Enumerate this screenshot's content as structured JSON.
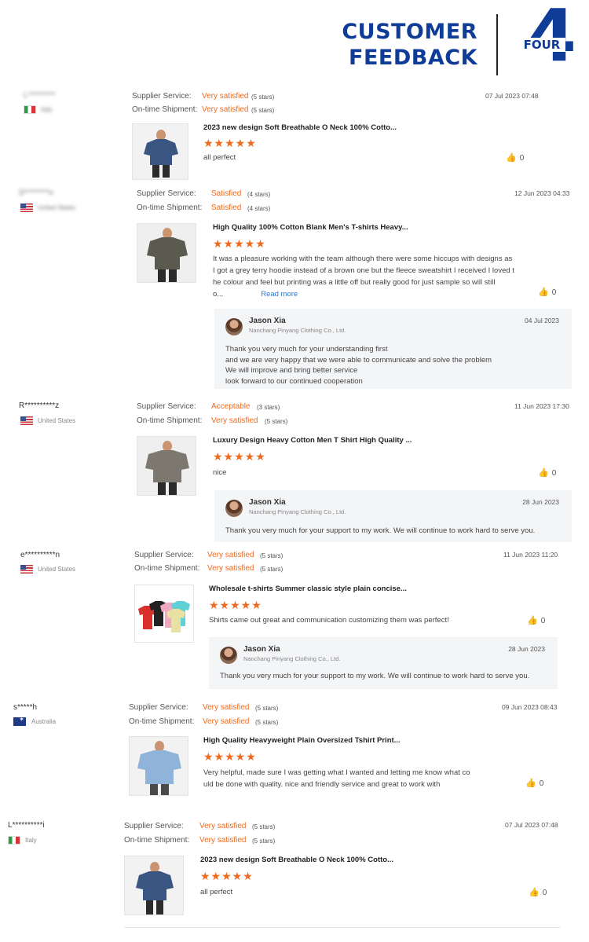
{
  "header": {
    "title_line1": "CUSTOMER",
    "title_line2": "FEEDBACK",
    "number": "4",
    "number_word": "FOUR"
  },
  "labels": {
    "supplier_service": "Supplier Service:",
    "ontime_shipment": "On-time Shipment:"
  },
  "reviews": [
    {
      "user": "L*********",
      "country": "Italy",
      "supplier_rating": "Very satisfied",
      "supplier_stars": "(5 stars)",
      "shipment_rating": "Very satisfied",
      "shipment_stars": "(5 stars)",
      "date": "07 Jul 2023 07:48",
      "product_title": "2023 new design Soft Breathable O Neck 100% Cotto...",
      "stars": "★★★★★",
      "text": "all perfect",
      "likes": "0",
      "thumbnail": "navy-tshirt"
    },
    {
      "user": "D********o",
      "country": "United States",
      "supplier_rating": "Satisfied",
      "supplier_stars": "(4 stars)",
      "shipment_rating": "Satisfied",
      "shipment_stars": "(4 stars)",
      "date": "12 Jun 2023 04:33",
      "product_title": "High Quality 100% Cotton Blank Men's T-shirts Heavy...",
      "stars": "★★★★★",
      "text_lines": [
        "It was a pleasure working with the team although there were some hiccups with designs as",
        "I got a grey terry hoodie instead of a brown one but the fleece sweatshirt I received I loved t",
        "he colour and feel but printing was a little off but really good for just sample so will still"
      ],
      "text_last": "o...",
      "read_more": "Read more",
      "likes": "0",
      "thumbnail": "olive-tshirt",
      "reply": {
        "name": "Jason Xia",
        "company": "Nanchang Pinyang Clothing Co., Ltd.",
        "date": "04 Jul 2023",
        "lines": [
          "Thank you very much for your understanding first",
          "and we are very happy that we were able to communicate and solve the problem",
          "We will improve and bring better service",
          "look forward to our continued cooperation"
        ]
      }
    },
    {
      "user": "R**********z",
      "country": "United States",
      "supplier_rating": "Acceptable",
      "supplier_stars": "(3 stars)",
      "shipment_rating": "Very satisfied",
      "shipment_stars": "(5 stars)",
      "date": "11 Jun 2023 17:30",
      "product_title": "Luxury Design Heavy Cotton Men T Shirt High Quality ...",
      "stars": "★★★★★",
      "text": "nice",
      "likes": "0",
      "thumbnail": "grey-tshirt",
      "reply": {
        "name": "Jason Xia",
        "company": "Nanchang Pinyang Clothing Co., Ltd.",
        "date": "28 Jun 2023",
        "lines": [
          "Thank you very much for your support to my work. We will continue to work hard to serve you."
        ]
      }
    },
    {
      "user": "e**********n",
      "country": "United States",
      "supplier_rating": "Very satisfied",
      "supplier_stars": "(5 stars)",
      "shipment_rating": "Very satisfied",
      "shipment_stars": "(5 stars)",
      "date": "11 Jun 2023 11:20",
      "product_title": "Wholesale t-shirts Summer classic style plain concise...",
      "stars": "★★★★★",
      "text": "Shirts came out great and communication customizing them was perfect!",
      "likes": "0",
      "thumbnail": "multicolor-tshirts",
      "reply": {
        "name": "Jason Xia",
        "company": "Nanchang Pinyang Clothing Co., Ltd.",
        "date": "28 Jun 2023",
        "lines": [
          "Thank you very much for your support to my work. We will continue to work hard to serve you."
        ]
      }
    },
    {
      "user": "s*****h",
      "country": "Australia",
      "supplier_rating": "Very satisfied",
      "supplier_stars": "(5 stars)",
      "shipment_rating": "Very satisfied",
      "shipment_stars": "(5 stars)",
      "date": "09 Jun 2023 08:43",
      "product_title": "High Quality Heavyweight Plain Oversized Tshirt Print...",
      "stars": "★★★★★",
      "text_lines": [
        "Very helpful, made sure I was getting what I wanted and letting me know what co",
        "uld be done with quality.  nice and friendly service and great to work with"
      ],
      "likes": "0",
      "thumbnail": "lightblue-tshirt"
    },
    {
      "user": "L**********i",
      "country": "Italy",
      "supplier_rating": "Very satisfied",
      "supplier_stars": "(5 stars)",
      "shipment_rating": "Very satisfied",
      "shipment_stars": "(5 stars)",
      "date": "07 Jul 2023 07:48",
      "product_title": "2023 new design Soft Breathable O Neck 100% Cotto...",
      "stars": "★★★★★",
      "text": "all perfect",
      "likes": "0",
      "thumbnail": "navy-tshirt"
    }
  ],
  "colors": {
    "brand_blue": "#0f3c96",
    "rating_orange": "#ef6a1d",
    "link_blue": "#2b7be0",
    "reply_bg": "#f4f5f7"
  }
}
